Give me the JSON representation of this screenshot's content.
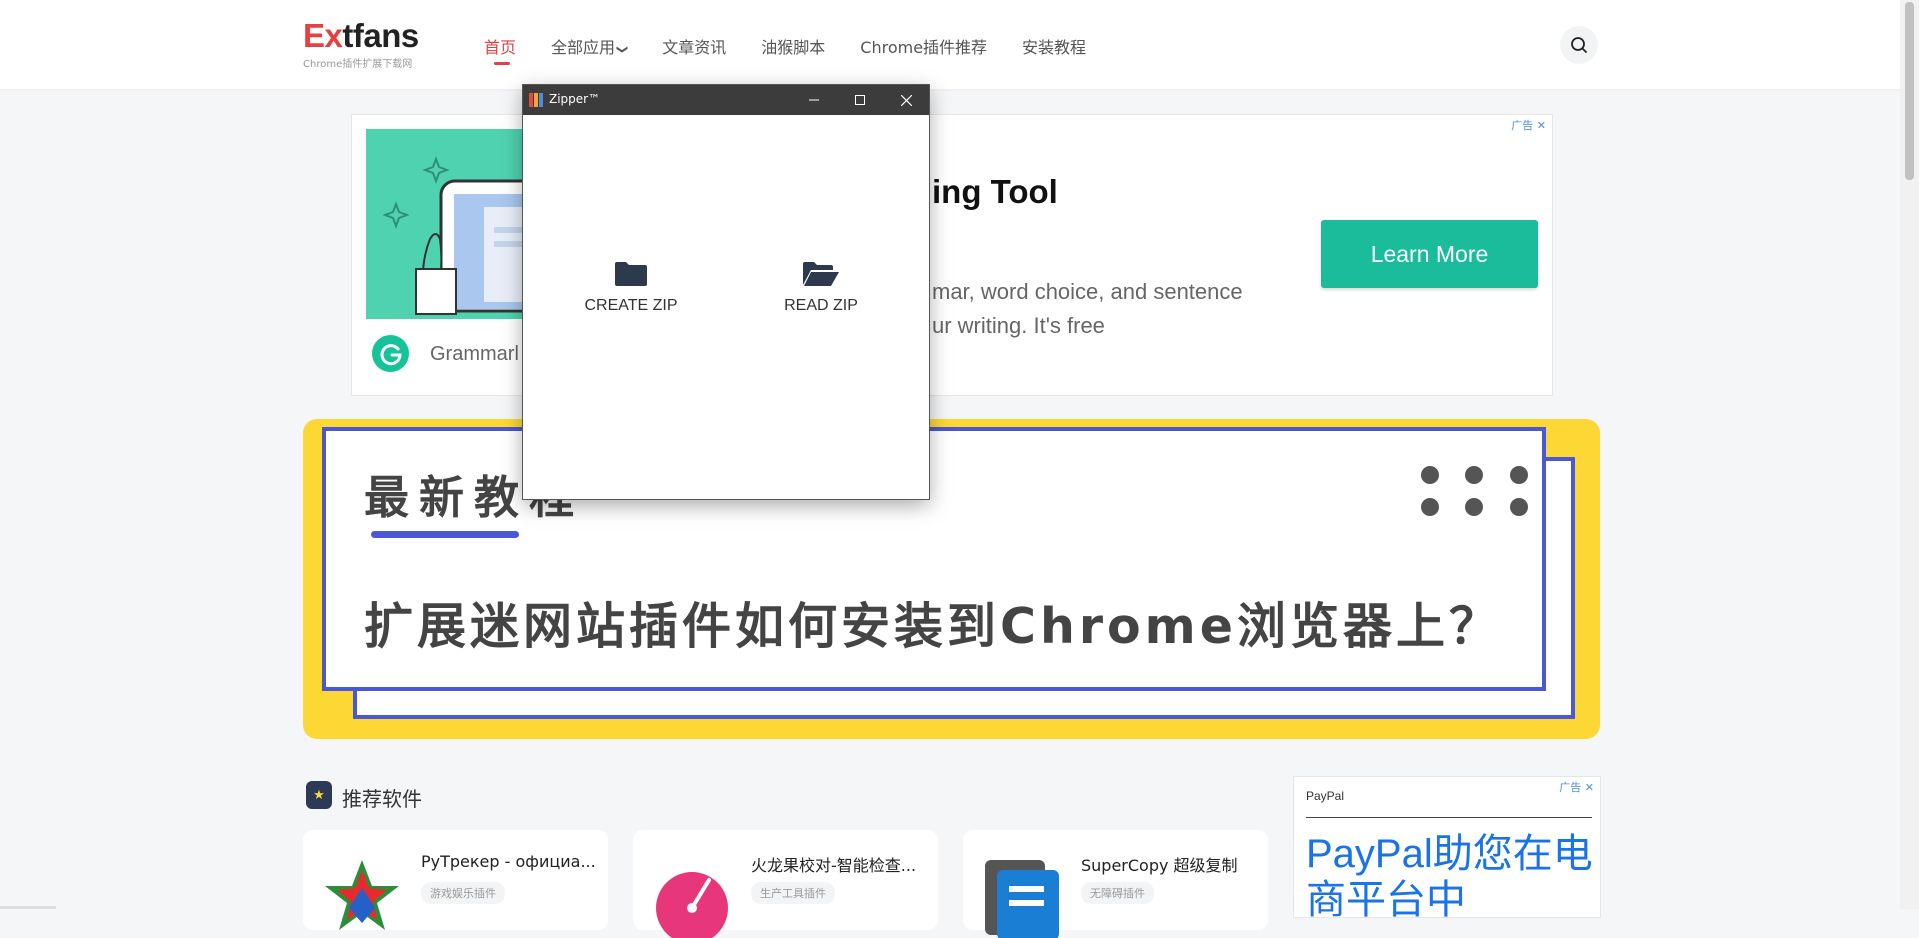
{
  "header": {
    "logo_ex": "Ex",
    "logo_rest": "tfans",
    "logo_sub": "Chrome插件扩展下载网",
    "nav": [
      "首页",
      "全部应用",
      "文章资讯",
      "油猴脚本",
      "Chrome插件推荐",
      "安装教程"
    ],
    "dropdown_chevron": "❯"
  },
  "ad_top": {
    "close_label": "广告",
    "title": "ing Tool",
    "desc_line1": "mar, word choice, and sentence",
    "desc_line2": "ur writing. It's free",
    "brand": "Grammarl",
    "cta": "Learn More"
  },
  "banner": {
    "heading": "最新教程",
    "headline": "扩展迷网站插件如何安装到Chrome浏览器上？"
  },
  "recommended": {
    "title": "推荐软件",
    "cards": [
      {
        "name": "РуТрекер - официа...",
        "tag": "游戏娱乐插件"
      },
      {
        "name": "火龙果校对-智能检查...",
        "tag": "生产工具插件"
      },
      {
        "name": "SuperCopy 超级复制",
        "tag": "无障碍插件"
      }
    ]
  },
  "ad_side": {
    "close_label": "广告",
    "brand": "PayPal",
    "headline": "PayPal助您在电商平台中"
  },
  "window": {
    "title": "Zipper™",
    "create_label": "CREATE ZIP",
    "read_label": "READ ZIP"
  },
  "colors": {
    "accent": "#e84040",
    "banner_yellow": "#fdd835",
    "banner_blue": "#4a57d6",
    "cta_green": "#1abc9c"
  }
}
